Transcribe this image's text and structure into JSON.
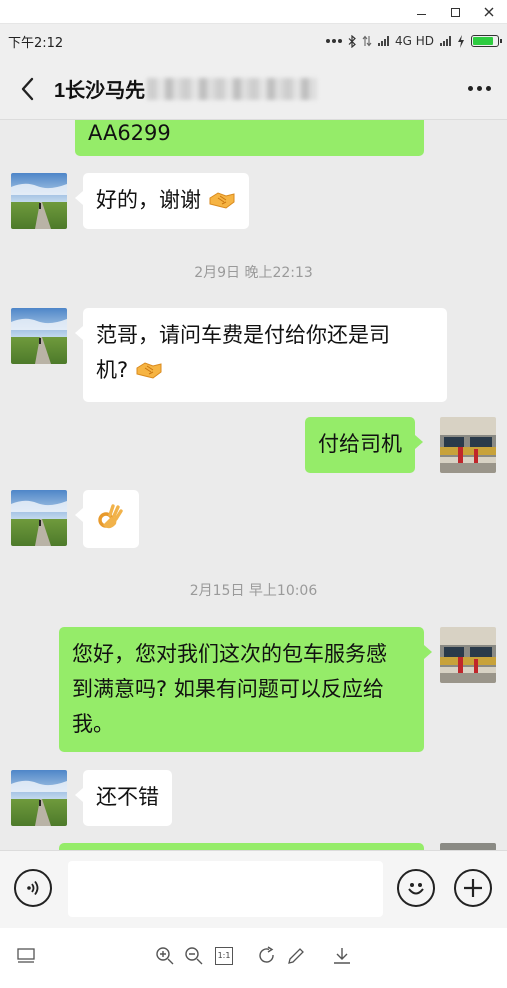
{
  "window": {
    "minimize_label": "–",
    "maximize_label": "□",
    "close_label": "×"
  },
  "status_bar": {
    "time": "下午2:12",
    "network": "4G HD",
    "battery_level": 0.85,
    "icons": [
      "more-dots-icon",
      "bluetooth-icon",
      "data-arrows-icon",
      "signal-icon",
      "signal-icon",
      "charging-icon",
      "battery-icon"
    ]
  },
  "header": {
    "title_visible": "1长沙马先",
    "back_icon": "back-chevron-icon",
    "more_icon": "more-dots-icon"
  },
  "messages": [
    {
      "side": "right",
      "text": "AA6299",
      "partial": true
    },
    {
      "side": "left",
      "text": "好的，谢谢",
      "emoji": "handshake"
    },
    {
      "timestamp": "2月9日 晚上22:13"
    },
    {
      "side": "left",
      "text_line1": "范哥，请问车费是付给你还是司",
      "text_line2": "机?",
      "emoji": "handshake"
    },
    {
      "side": "right",
      "text": "付给司机"
    },
    {
      "side": "left",
      "emoji": "ok-hand"
    },
    {
      "timestamp": "2月15日 早上10:06"
    },
    {
      "side": "right",
      "text_line1": "您好，您对我们这次的包车服务感",
      "text_line2": "到满意吗? 如果有问题可以反应给",
      "text_line3": "我。"
    },
    {
      "side": "left",
      "text": "还不错"
    }
  ],
  "input_bar": {
    "voice_icon": "voice-icon",
    "input_value": "",
    "emoji_icon": "smiley-icon",
    "plus_icon": "plus-icon"
  },
  "toolbar": {
    "icons": [
      "screen-icon",
      "zoom-in-icon",
      "zoom-out-icon",
      "actual-size-icon",
      "rotate-icon",
      "edit-icon",
      "download-icon"
    ],
    "actual_size_label": "1:1"
  },
  "colors": {
    "chat_background": "#ebebeb",
    "bubble_self": "#95ec69",
    "bubble_other": "#ffffff",
    "header_background": "#efefef"
  }
}
